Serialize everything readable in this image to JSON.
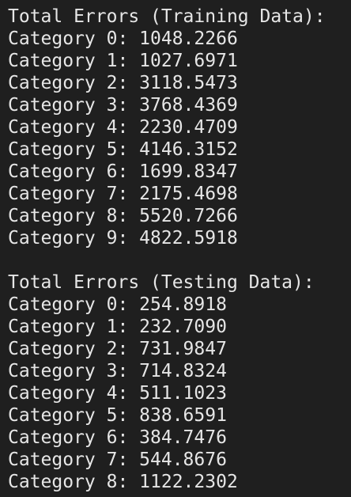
{
  "terminal": {
    "training": {
      "header": "Total Errors (Training Data):",
      "lines": [
        "Category 0: 1048.2266",
        "Category 1: 1027.6971",
        "Category 2: 3118.5473",
        "Category 3: 3768.4369",
        "Category 4: 2230.4709",
        "Category 5: 4146.3152",
        "Category 6: 1699.8347",
        "Category 7: 2175.4698",
        "Category 8: 5520.7266",
        "Category 9: 4822.5918"
      ]
    },
    "testing": {
      "header": "Total Errors (Testing Data):",
      "lines": [
        "Category 0: 254.8918",
        "Category 1: 232.7090",
        "Category 2: 731.9847",
        "Category 3: 714.8324",
        "Category 4: 511.1023",
        "Category 5: 838.6591",
        "Category 6: 384.7476",
        "Category 7: 544.8676",
        "Category 8: 1122.2302"
      ]
    }
  }
}
